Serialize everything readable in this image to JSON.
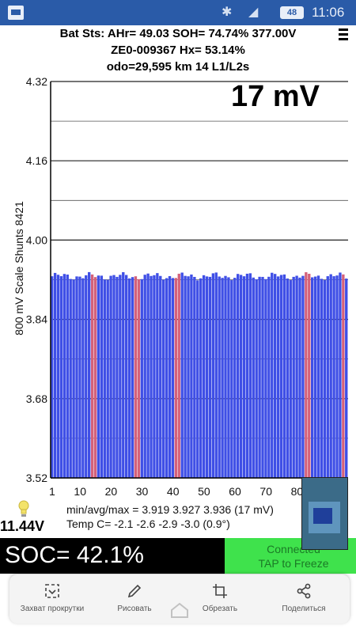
{
  "status_bar": {
    "battery": "48",
    "time": "11:06",
    "colors": {
      "bar": "#2a5ba8"
    }
  },
  "header": {
    "line1": "Bat Sts: AHr= 49.03 SOH= 74.74% 377.00V",
    "line2": "ZE0-009367   Hx= 53.14%",
    "line3": "odo=29,595 km  14 L1/L2s"
  },
  "cell_delta": "17 mV",
  "y_axis_label": "800 mV Scale   Shunts 8421",
  "chart_data": {
    "type": "bar",
    "ylim": [
      3.52,
      4.32
    ],
    "y_ticks": [
      "4.32",
      "4.16",
      "4.00",
      "3.84",
      "3.68",
      "3.52"
    ],
    "x_ticks": [
      "1",
      "10",
      "20",
      "30",
      "40",
      "50",
      "60",
      "70",
      "80"
    ],
    "grid": true,
    "categories_count": 96,
    "values_summary": {
      "min": 3.919,
      "avg": 3.927,
      "max": 3.936
    },
    "shunted_cells": [
      14,
      15,
      28,
      29,
      41,
      42,
      83,
      84,
      95
    ],
    "colors": {
      "bar": "#3f4fe6",
      "shunt": "#d4617a",
      "grid": "#000000"
    }
  },
  "pack_voltage": "11.44V",
  "stats": {
    "minmax": "min/avg/max = 3.919  3.927  3.936  (17 mV)",
    "temp": "Temp C= -2.1  -2.6  -2.9  -3.0  (0.9°)"
  },
  "soc": "SOC= 42.1%",
  "connect": {
    "line1": "Connected",
    "line2": "TAP to Freeze",
    "color": "#3fe24c"
  },
  "share_sheet": {
    "actions": [
      {
        "label": "Захват прокрутки",
        "icon": "scroll-capture-icon"
      },
      {
        "label": "Рисовать",
        "icon": "pencil-icon"
      },
      {
        "label": "Обрезать",
        "icon": "crop-icon"
      },
      {
        "label": "Поделиться",
        "icon": "share-icon"
      }
    ]
  }
}
